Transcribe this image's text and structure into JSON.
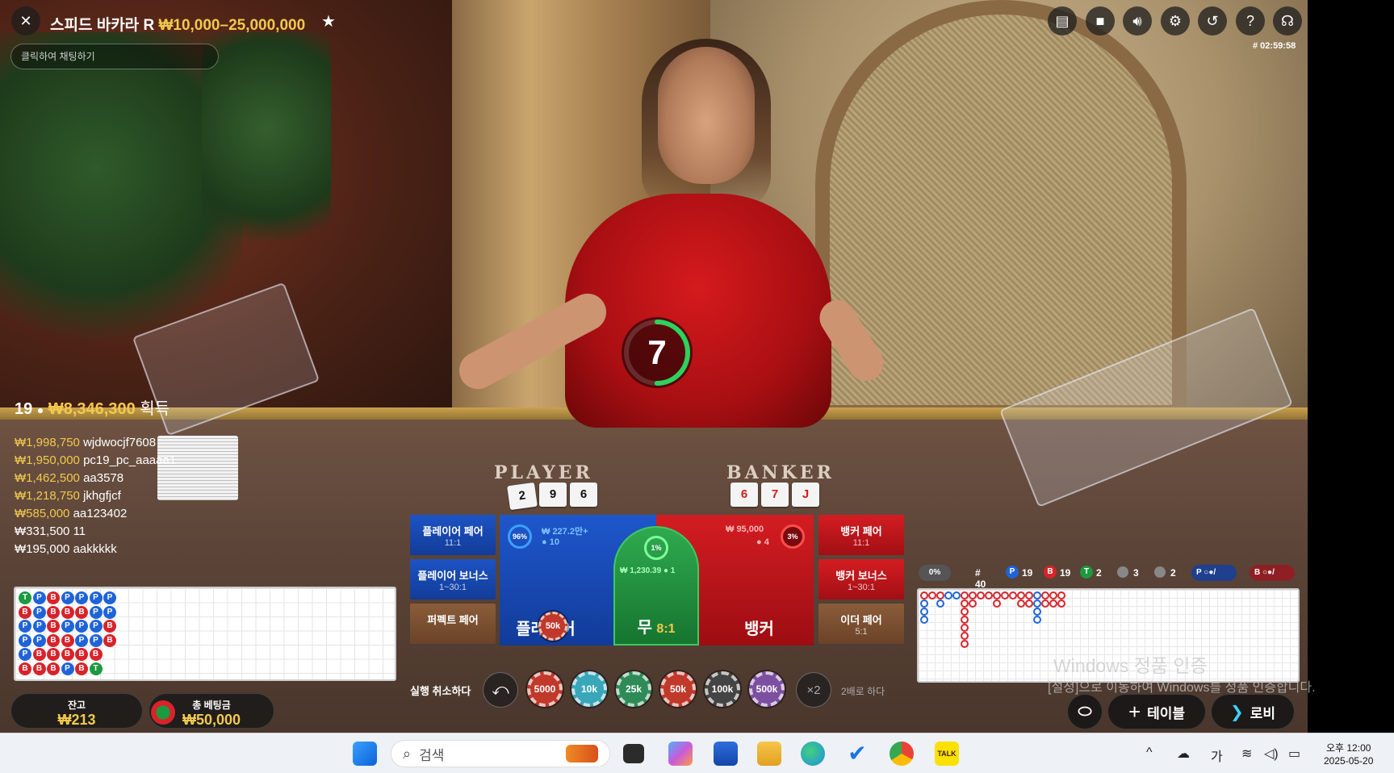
{
  "header": {
    "title": "스피드 바카라 R",
    "limits": "₩10,000–25,000,000",
    "chat_placeholder": "클릭하여 채팅하기",
    "round_id": "# 02:59:58"
  },
  "timer": {
    "value": "7",
    "fraction_remaining": 0.5
  },
  "felt": {
    "player_label": "PLAYER",
    "banker_label": "BANKER"
  },
  "winners": {
    "count": "19",
    "total": "₩8,346,300",
    "suffix": "획득",
    "list": [
      {
        "amount": "₩1,998,750",
        "name": "wjdwocjf7608"
      },
      {
        "amount": "₩1,950,000",
        "name": "pc19_pc_aaaaa1"
      },
      {
        "amount": "₩1,462,500",
        "name": "aa3578"
      },
      {
        "amount": "₩1,218,750",
        "name": "jkhgfjcf"
      },
      {
        "amount": "₩585,000",
        "name": "aa123402"
      },
      {
        "amount": "₩331,500",
        "name": "11"
      },
      {
        "amount": "₩195,000",
        "name": "aakkkkk"
      }
    ]
  },
  "bead_road": [
    [
      "T",
      "P",
      "B",
      "P",
      "P",
      "P",
      "P"
    ],
    [
      "B",
      "P",
      "B",
      "B",
      "B",
      "P",
      "P"
    ],
    [
      "P",
      "P",
      "B",
      "P",
      "P",
      "P",
      "B"
    ],
    [
      "P",
      "P",
      "B",
      "B",
      "P",
      "P",
      "B"
    ],
    [
      "P",
      "B",
      "B",
      "B",
      "B",
      "B",
      ""
    ],
    [
      "B",
      "B",
      "B",
      "P",
      "B",
      "T",
      ""
    ]
  ],
  "balance": {
    "label": "잔고",
    "value": "₩213"
  },
  "total_bet": {
    "label": "총 베팅금",
    "value": "₩50,000"
  },
  "bets": {
    "player_pair": {
      "label": "플레이어 페어",
      "odds": "11:1"
    },
    "player_bonus": {
      "label": "플레이어 보너스",
      "odds": "1~30:1"
    },
    "perfect_pair": {
      "label": "퍼펙트 페어",
      "odds": ""
    },
    "banker_pair": {
      "label": "뱅커 페어",
      "odds": "11:1"
    },
    "banker_bonus": {
      "label": "뱅커 보너스",
      "odds": "1~30:1"
    },
    "either_pair": {
      "label": "이더 페어",
      "odds": "5:1"
    },
    "player": {
      "label": "플레이어",
      "pct": "96%",
      "amount": "₩ 227.2만+",
      "players": "10",
      "chip": "50k"
    },
    "tie": {
      "label": "무",
      "odds": "8:1",
      "pct": "1%",
      "amount": "₩ 1,230.39",
      "players": "1"
    },
    "banker": {
      "label": "뱅커",
      "pct": "3%",
      "amount": "₩ 95,000",
      "players": "4"
    }
  },
  "controls": {
    "undo_label": "실행 취소하다",
    "double_label": "2배로 하다",
    "double_symbol": "×2",
    "chips": [
      {
        "label": "5000",
        "color": "#c0392b"
      },
      {
        "label": "10k",
        "color": "#3aa6b9"
      },
      {
        "label": "25k",
        "color": "#2e8b57"
      },
      {
        "label": "50k",
        "color": "#c0392b"
      },
      {
        "label": "100k",
        "color": "#444444"
      },
      {
        "label": "500k",
        "color": "#7d4fa1"
      }
    ]
  },
  "road_stats": {
    "percent": "0%",
    "total": "# 40",
    "player": "19",
    "banker": "19",
    "tie": "2",
    "player_pair": "3",
    "banker_pair": "2",
    "p_symbol": "P",
    "b_symbol": "B",
    "t_symbol": "T"
  },
  "nav": {
    "table": "테이블",
    "lobby": "로비"
  },
  "watermark": {
    "line1": "Windows 정품 인증",
    "line2": "[설정]으로 이동하여 Windows를 정품 인증합니다."
  },
  "taskbar": {
    "search": "검색",
    "ime": "가",
    "time": "오후 12:00",
    "date": "2025-05-20"
  },
  "colors": {
    "player": "#1f63d8",
    "banker": "#d8232a",
    "tie": "#1c9a3f",
    "gold": "#f2c94c"
  }
}
